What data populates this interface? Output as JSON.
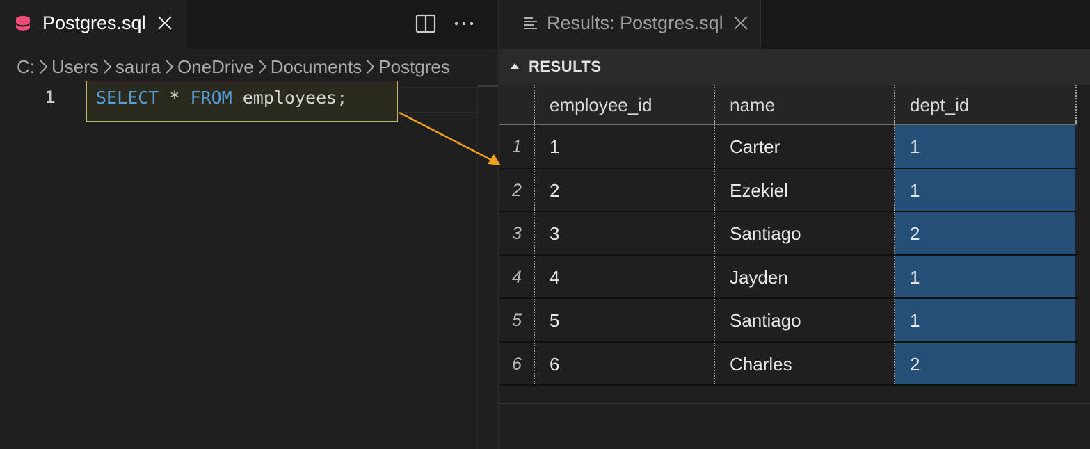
{
  "editor": {
    "tab": {
      "label": "Postgres.sql",
      "icon": "database-icon",
      "icon_color": "#f14c78"
    },
    "breadcrumb": [
      "C:",
      "Users",
      "saura",
      "OneDrive",
      "Documents",
      "Postgres"
    ],
    "line_number": "1",
    "code": {
      "kw1": "SELECT",
      "mid": " * ",
      "kw2": "FROM",
      "rest": " employees;"
    },
    "actions": [
      "split-editor-icon",
      "more-actions-icon"
    ]
  },
  "results": {
    "tab": {
      "label": "Results: Postgres.sql",
      "icon": "results-list-icon"
    },
    "heading": "RESULTS",
    "columns": [
      "employee_id",
      "name",
      "dept_id"
    ],
    "rows": [
      {
        "n": "1",
        "employee_id": "1",
        "name": "Carter",
        "dept_id": "1"
      },
      {
        "n": "2",
        "employee_id": "2",
        "name": "Ezekiel",
        "dept_id": "1"
      },
      {
        "n": "3",
        "employee_id": "3",
        "name": "Santiago",
        "dept_id": "2"
      },
      {
        "n": "4",
        "employee_id": "4",
        "name": "Jayden",
        "dept_id": "1"
      },
      {
        "n": "5",
        "employee_id": "5",
        "name": "Santiago",
        "dept_id": "1"
      },
      {
        "n": "6",
        "employee_id": "6",
        "name": "Charles",
        "dept_id": "2"
      }
    ],
    "selection_color": "#264f78"
  },
  "annotation": {
    "arrow_color": "#f0a020",
    "highlight_border": "#c8b46a"
  }
}
